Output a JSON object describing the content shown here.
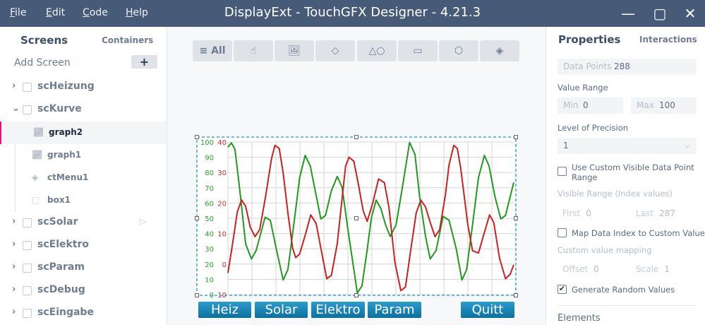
{
  "titlebar": {
    "menu": [
      "File",
      "Edit",
      "Code",
      "Help"
    ],
    "title": "DisplayExt - TouchGFX Designer - 4.21.3",
    "controls": {
      "minimize": "—",
      "maximize": "▢",
      "close": "✕"
    }
  },
  "left": {
    "tabs": {
      "screens": "Screens",
      "containers": "Containers"
    },
    "add_screen": "Add Screen",
    "add_icon": "+",
    "screens": [
      {
        "name": "scHeizung",
        "expanded": false
      },
      {
        "name": "scKurve",
        "expanded": true,
        "children": [
          {
            "name": "graph2",
            "icon": "graph-icon",
            "selected": true
          },
          {
            "name": "graph1",
            "icon": "graph-icon"
          },
          {
            "name": "ctMenu1",
            "icon": "layers-icon"
          },
          {
            "name": "box1",
            "icon": "box-icon"
          }
        ]
      },
      {
        "name": "scSolar",
        "expanded": false,
        "start": true
      },
      {
        "name": "scElektro"
      },
      {
        "name": "scParam"
      },
      {
        "name": "scDebug"
      },
      {
        "name": "scEingabe"
      }
    ]
  },
  "toolbar": {
    "all": "≡ All",
    "icons": [
      "interaction-icon",
      "image-icon",
      "containers-icon",
      "shapes-icon",
      "progress-icon",
      "3d-cube-icon",
      "layers-icon"
    ]
  },
  "canvas": {
    "buttons": [
      "Heiz",
      "Solar",
      "Elektro",
      "Param",
      "Quitt"
    ]
  },
  "properties": {
    "tabs": {
      "properties": "Properties",
      "interactions": "Interactions"
    },
    "data_points_label": "Data Points",
    "data_points": "288",
    "value_range": "Value Range",
    "min_label": "Min",
    "min": "0",
    "max_label": "Max",
    "max": "100",
    "precision_label": "Level of Precision",
    "precision": "1",
    "use_custom_range": "Use Custom Visible Data Point Range",
    "use_custom_checked": false,
    "visible_range": "Visible Range (Index values)",
    "first_label": "First",
    "first": "0",
    "last_label": "Last",
    "last": "287",
    "map_index": "Map Data Index to Custom Value",
    "map_checked": false,
    "custom_mapping": "Custom value mapping",
    "offset_label": "Offset",
    "offset": "0",
    "scale_label": "Scale",
    "scale": "1",
    "generate_random": "Generate Random Values",
    "generate_checked": true,
    "elements": "Elements"
  },
  "chart_data": {
    "type": "line",
    "x_range": [
      0,
      287
    ],
    "y_left_green": {
      "ticks": [
        "100",
        "90",
        "80",
        "70",
        "60",
        "50",
        "40",
        "30",
        "20",
        "10",
        "0"
      ],
      "range": [
        0,
        100
      ],
      "color": "#2ca02c"
    },
    "y_left_red": {
      "ticks": [
        "40",
        "30",
        "20",
        "10",
        "0",
        "-10"
      ],
      "range": [
        -10,
        40
      ],
      "color": "#d62728"
    },
    "grid": true,
    "series": [
      {
        "name": "green",
        "color": "#1f9a1f",
        "axis": "green",
        "points": [
          [
            0,
            96.6
          ],
          [
            3.5,
            99.4
          ],
          [
            7.1,
            95.1
          ],
          [
            11.8,
            68.9
          ],
          [
            17.7,
            33.4
          ],
          [
            23.6,
            23.4
          ],
          [
            28.3,
            28.8
          ],
          [
            37.3,
            50.7
          ],
          [
            42.5,
            48.8
          ],
          [
            48.4,
            30.4
          ],
          [
            55.5,
            9.6
          ],
          [
            60.2,
            16.5
          ],
          [
            66.1,
            45.8
          ],
          [
            72,
            76.6
          ],
          [
            77.5,
            91.2
          ],
          [
            82.7,
            84.3
          ],
          [
            87.4,
            68.9
          ],
          [
            93.3,
            49.6
          ],
          [
            98,
            51.9
          ],
          [
            103.9,
            68.1
          ],
          [
            109.8,
            77.4
          ],
          [
            114.6,
            70.4
          ],
          [
            120.5,
            42.7
          ],
          [
            129.9,
            1.1
          ],
          [
            134.6,
            5.7
          ],
          [
            139.4,
            27.3
          ],
          [
            144.1,
            50.4
          ],
          [
            148.8,
            61.9
          ],
          [
            153.5,
            56.5
          ],
          [
            158.3,
            45.8
          ],
          [
            163,
            38.1
          ],
          [
            168.9,
            45.8
          ],
          [
            174.8,
            68.9
          ],
          [
            182.4,
            99.7
          ],
          [
            187.8,
            92
          ],
          [
            192.5,
            64.3
          ],
          [
            198.4,
            38.1
          ],
          [
            203.1,
            23.4
          ],
          [
            209,
            28.8
          ],
          [
            216.1,
            51.2
          ],
          [
            222,
            48.8
          ],
          [
            229.1,
            30.4
          ],
          [
            235,
            9.6
          ],
          [
            239.7,
            16.5
          ],
          [
            245.6,
            45.8
          ],
          [
            251.6,
            76.6
          ],
          [
            257.5,
            91.2
          ],
          [
            262.2,
            84.3
          ],
          [
            268.1,
            64.3
          ],
          [
            274,
            49.6
          ],
          [
            278.7,
            51.9
          ],
          [
            287,
            73.5
          ]
        ]
      },
      {
        "name": "red",
        "color": "#cc1f1f",
        "axis": "red",
        "points": [
          [
            0,
            -2.9
          ],
          [
            4.7,
            6.7
          ],
          [
            9.4,
            17.1
          ],
          [
            13.7,
            21
          ],
          [
            17.7,
            19
          ],
          [
            22.4,
            12.1
          ],
          [
            27.2,
            9
          ],
          [
            31.9,
            11.3
          ],
          [
            37.8,
            22.1
          ],
          [
            43.7,
            34.5
          ],
          [
            47.2,
            38.9
          ],
          [
            51.5,
            37.9
          ],
          [
            55.5,
            29.8
          ],
          [
            60.2,
            16.7
          ],
          [
            65,
            5.2
          ],
          [
            68,
            2.1
          ],
          [
            72,
            3.3
          ],
          [
            77.9,
            9.8
          ],
          [
            83.1,
            16.1
          ],
          [
            88.6,
            13.3
          ],
          [
            93.3,
            5.2
          ],
          [
            99.2,
            -4.8
          ],
          [
            103.9,
            -3.7
          ],
          [
            109.8,
            6.7
          ],
          [
            118.1,
            32.1
          ],
          [
            121.6,
            35
          ],
          [
            126.4,
            33.7
          ],
          [
            131.1,
            26
          ],
          [
            135.8,
            17.5
          ],
          [
            139.8,
            14
          ],
          [
            145.3,
            19.8
          ],
          [
            151.2,
            27.9
          ],
          [
            157.1,
            26.7
          ],
          [
            161.8,
            18.3
          ],
          [
            167.7,
            0.6
          ],
          [
            173.6,
            -8.7
          ],
          [
            178.3,
            -7.5
          ],
          [
            183.1,
            3.6
          ],
          [
            189,
            16.7
          ],
          [
            193.7,
            21
          ],
          [
            198.4,
            18.7
          ],
          [
            203.1,
            13.7
          ],
          [
            207.9,
            9
          ],
          [
            212.6,
            11.3
          ],
          [
            218.5,
            22.9
          ],
          [
            222,
            32.5
          ],
          [
            226.8,
            38.9
          ],
          [
            230.3,
            37.9
          ],
          [
            233.8,
            31.4
          ],
          [
            240.9,
            12.9
          ],
          [
            245.6,
            4.4
          ],
          [
            251.6,
            3.6
          ],
          [
            256.3,
            9
          ],
          [
            262.7,
            16.1
          ],
          [
            266.9,
            13.7
          ],
          [
            272.8,
            1.8
          ],
          [
            278.7,
            -4.8
          ],
          [
            283.4,
            -3.3
          ],
          [
            287,
            -0.2
          ]
        ]
      }
    ]
  }
}
